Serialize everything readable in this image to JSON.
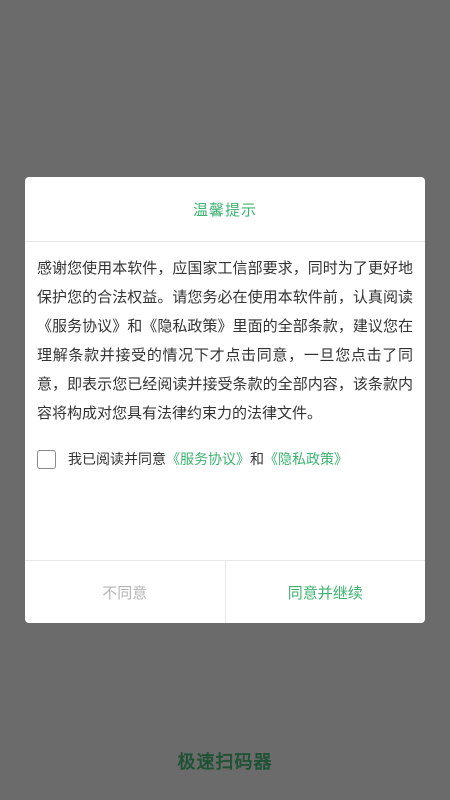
{
  "dialog": {
    "title": "温馨提示",
    "body": "感谢您使用本软件，应国家工信部要求，同时为了更好地保护您的合法权益。请您务必在使用本软件前，认真阅读《服务协议》和《隐私政策》里面的全部条款，建议您在理解条款并接受的情况下才点击同意，一旦您点击了同意，即表示您已经阅读并接受条款的全部内容，该条款内容将构成对您具有法律约束力的法律文件。",
    "agreement": {
      "prefix": "我已阅读并同意",
      "service_link": "《服务协议》",
      "conjunction": "和",
      "privacy_link": "《隐私政策》",
      "checked": false
    },
    "buttons": {
      "disagree": "不同意",
      "agree": "同意并继续"
    }
  },
  "app": {
    "name": "极速扫码器"
  },
  "colors": {
    "accent": "#3cb371",
    "backdrop": "#6b6b6b",
    "app_name": "#1f5234",
    "disabled_text": "#b5b5b5"
  }
}
